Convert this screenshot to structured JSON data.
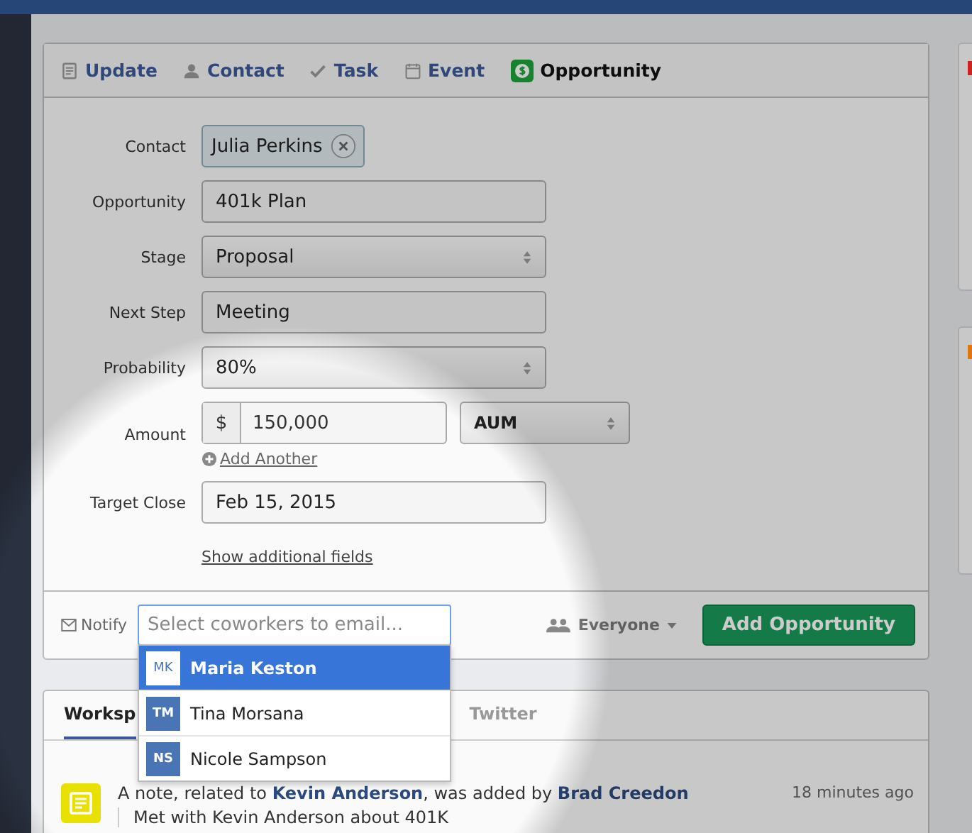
{
  "tabs": [
    {
      "label": "Update",
      "selected": false
    },
    {
      "label": "Contact",
      "selected": false
    },
    {
      "label": "Task",
      "selected": false
    },
    {
      "label": "Event",
      "selected": false
    },
    {
      "label": "Opportunity",
      "selected": true
    }
  ],
  "form": {
    "rows": [
      {
        "kind": "token",
        "label": "Contact",
        "value": "Julia Perkins"
      },
      {
        "kind": "text",
        "label": "Opportunity",
        "value": "401k Plan"
      },
      {
        "kind": "select",
        "label": "Stage",
        "value": "Proposal"
      },
      {
        "kind": "text",
        "label": "Next Step",
        "value": "Meeting"
      },
      {
        "kind": "select",
        "label": "Probability",
        "value": "80%"
      },
      {
        "kind": "amount",
        "label": "Amount",
        "currency": "$",
        "value": "150,000",
        "unit": "AUM",
        "add_link": "Add Another"
      },
      {
        "kind": "text",
        "label": "Target Close",
        "value": "Feb 15, 2015"
      }
    ],
    "more_link": "Show additional fields"
  },
  "footer": {
    "notify_label": "Notify",
    "notify_field": {
      "placeholder": "Select coworkers to email..."
    },
    "visibility": "Everyone",
    "submit": "Add Opportunity"
  },
  "suggestions": [
    {
      "initials": "MK",
      "name": "Maria Keston",
      "selected": true
    },
    {
      "initials": "TM",
      "name": "Tina Morsana",
      "selected": false
    },
    {
      "initials": "NS",
      "name": "Nicole Sampson",
      "selected": false
    }
  ],
  "feed": {
    "tabs": [
      {
        "label": "Worksp",
        "selected": true
      },
      {
        "label": "Twitter",
        "selected": false
      }
    ],
    "items": [
      {
        "text": "A note, related to **Kevin Anderson**, was added by **Brad Creedon**",
        "time": "18 minutes ago",
        "body": "Met with Kevin Anderson about 401K"
      }
    ]
  },
  "side_panels": [
    {
      "color": "#cc2222"
    },
    {
      "color": "#dd7711"
    }
  ]
}
